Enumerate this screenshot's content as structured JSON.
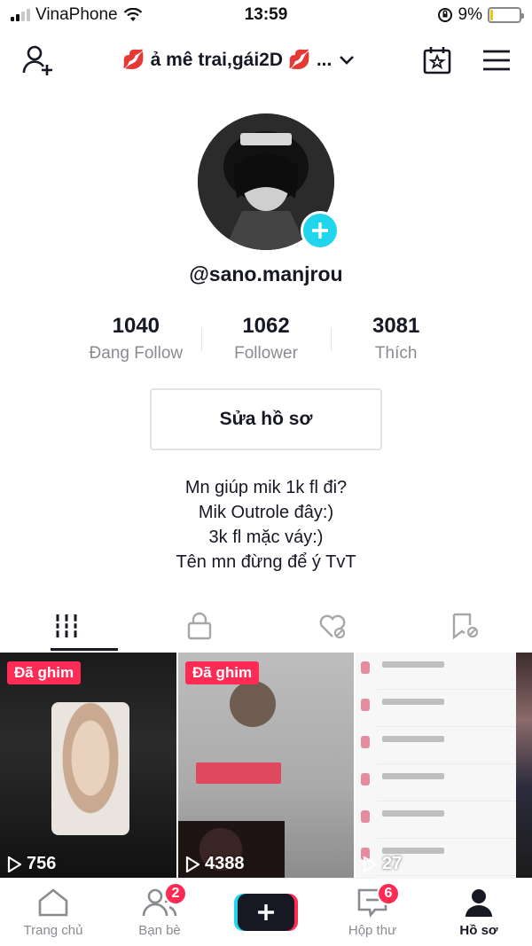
{
  "status_bar": {
    "carrier": "VinaPhone",
    "time": "13:59",
    "battery": "9%",
    "battery_level": 0.09
  },
  "header": {
    "title": "💋 ả mê trai,gái2D 💋 ..."
  },
  "profile": {
    "username": "@sano.manjrou",
    "stats": [
      {
        "value": "1040",
        "label": "Đang Follow"
      },
      {
        "value": "1062",
        "label": "Follower"
      },
      {
        "value": "3081",
        "label": "Thích"
      }
    ],
    "edit_label": "Sửa hồ sơ",
    "bio": [
      "Mn giúp mik 1k fl đi?",
      "Mik Outrole đây:)",
      "3k fl mặc váy:)",
      "Tên mn đừng để ý TvT"
    ]
  },
  "videos": [
    {
      "pinned": "Đã ghim",
      "views": "756"
    },
    {
      "pinned": "Đã ghim",
      "views": "4388"
    },
    {
      "pinned": "",
      "views": "27"
    }
  ],
  "bottom_nav": [
    {
      "label": "Trang chủ",
      "icon": "home-icon"
    },
    {
      "label": "Bạn bè",
      "icon": "friends-icon",
      "badge": "2"
    },
    {
      "label": "",
      "icon": "plus-icon"
    },
    {
      "label": "Hộp thư",
      "icon": "inbox-icon",
      "badge": "6"
    },
    {
      "label": "Hồ sơ",
      "icon": "profile-icon"
    }
  ],
  "colors": {
    "accent_pink": "#fe2c55",
    "accent_cyan": "#20d5ec",
    "text": "#161823",
    "muted": "#8a8b91"
  }
}
